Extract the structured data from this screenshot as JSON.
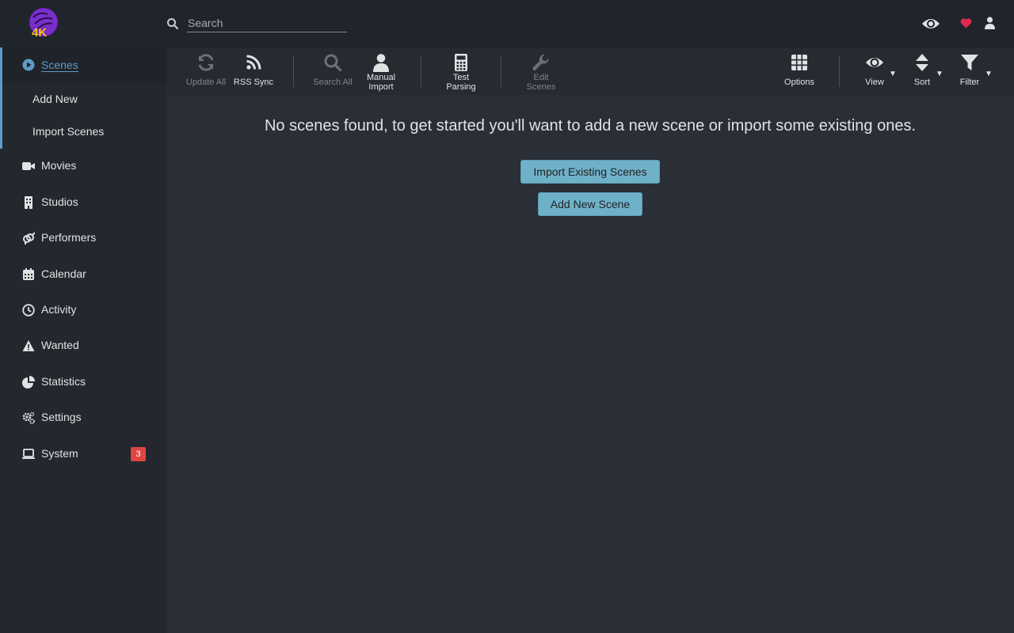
{
  "header": {
    "search_placeholder": "Search",
    "logo_text": "4K"
  },
  "sidebar": {
    "scenes": "Scenes",
    "scenes_sub": [
      "Add New",
      "Import Scenes"
    ],
    "items": [
      {
        "label": "Movies",
        "icon": "video-camera-icon"
      },
      {
        "label": "Studios",
        "icon": "building-icon"
      },
      {
        "label": "Performers",
        "icon": "gender-icon"
      },
      {
        "label": "Calendar",
        "icon": "calendar-icon"
      },
      {
        "label": "Activity",
        "icon": "clock-icon"
      },
      {
        "label": "Wanted",
        "icon": "warning-icon"
      },
      {
        "label": "Statistics",
        "icon": "pie-chart-icon"
      },
      {
        "label": "Settings",
        "icon": "gears-icon"
      },
      {
        "label": "System",
        "icon": "laptop-icon"
      }
    ],
    "system_badge": "3"
  },
  "toolbar": {
    "update_all": "Update All",
    "rss_sync": "RSS Sync",
    "search_all": "Search All",
    "manual_import_1": "Manual",
    "manual_import_2": "Import",
    "test_parsing_1": "Test",
    "test_parsing_2": "Parsing",
    "edit_scenes_1": "Edit",
    "edit_scenes_2": "Scenes",
    "options": "Options",
    "view": "View",
    "sort": "Sort",
    "filter": "Filter"
  },
  "main": {
    "empty_message": "No scenes found, to get started you'll want to add a new scene or import some existing ones.",
    "import_button": "Import Existing Scenes",
    "add_button": "Add New Scene"
  },
  "colors": {
    "accent": "#5d9cc8",
    "button": "#6eb1c9",
    "badge": "#e04440",
    "heart": "#e0284f",
    "logo_purple": "#7b2fc9",
    "logo_yellow": "#f5c518"
  }
}
